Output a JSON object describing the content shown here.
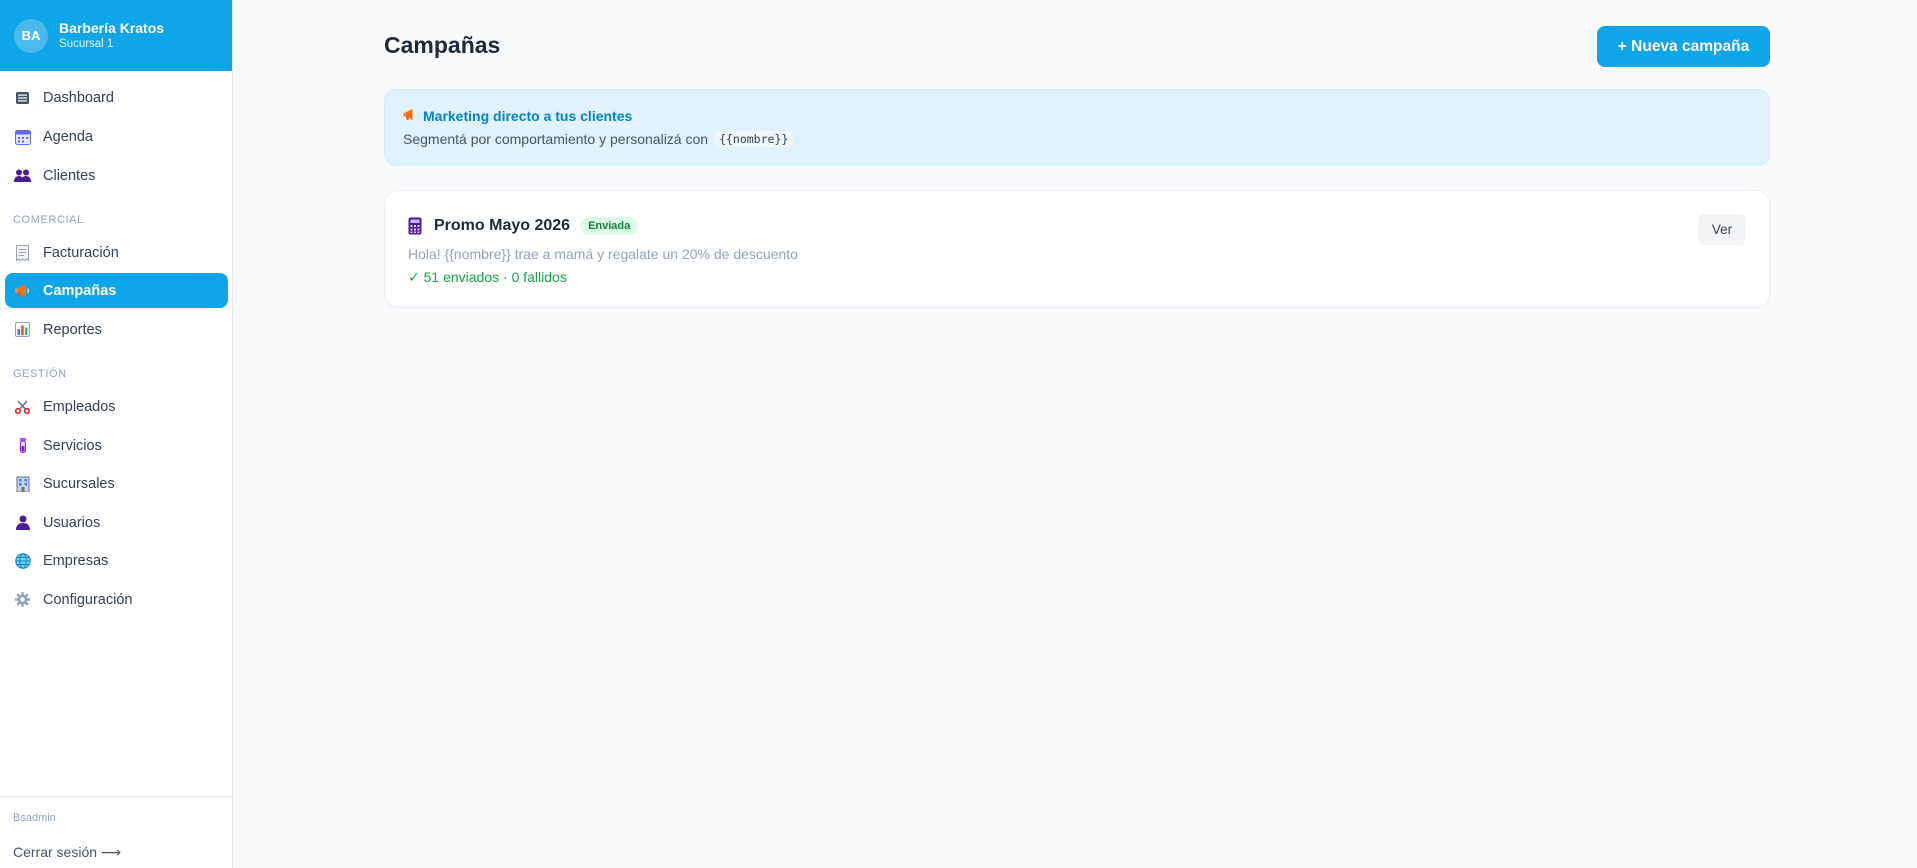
{
  "brand": {
    "initials": "BA",
    "name": "Barbería Kratos",
    "branch": "Sucursal 1",
    "color": "#0ea5e9"
  },
  "sidebar": {
    "items_top": [
      {
        "label": "Dashboard",
        "icon": "list-icon"
      },
      {
        "label": "Agenda",
        "icon": "calendar-icon"
      },
      {
        "label": "Clientes",
        "icon": "users-icon"
      }
    ],
    "section_comercial": "COMERCIAL",
    "items_comercial": [
      {
        "label": "Facturación",
        "icon": "receipt-icon"
      },
      {
        "label": "Campañas",
        "icon": "megaphone-icon",
        "active": true
      },
      {
        "label": "Reportes",
        "icon": "bar-chart-icon"
      }
    ],
    "section_gestion": "GESTIÓN",
    "items_gestion": [
      {
        "label": "Empleados",
        "icon": "scissors-icon"
      },
      {
        "label": "Servicios",
        "icon": "tube-icon"
      },
      {
        "label": "Sucursales",
        "icon": "building-icon"
      },
      {
        "label": "Usuarios",
        "icon": "user-icon"
      },
      {
        "label": "Empresas",
        "icon": "globe-icon"
      },
      {
        "label": "Configuración",
        "icon": "gear-icon"
      }
    ],
    "footer_user": "Bsadmin",
    "logout_label": "Cerrar sesión ⟶"
  },
  "main": {
    "title": "Campañas",
    "new_button": "+ Nueva campaña",
    "info": {
      "title": "Marketing directo a tus clientes",
      "text": "Segmentá por comportamiento y personalizá con",
      "placeholder_token": "{{nombre}}"
    },
    "campaigns": [
      {
        "title": "Promo Mayo 2026",
        "status": "Enviada",
        "message": "Hola! {{nombre}} trae a mamá y regalate un 20% de descuento",
        "stats": "✓ 51 enviados · 0 fallidos",
        "action": "Ver"
      }
    ]
  }
}
